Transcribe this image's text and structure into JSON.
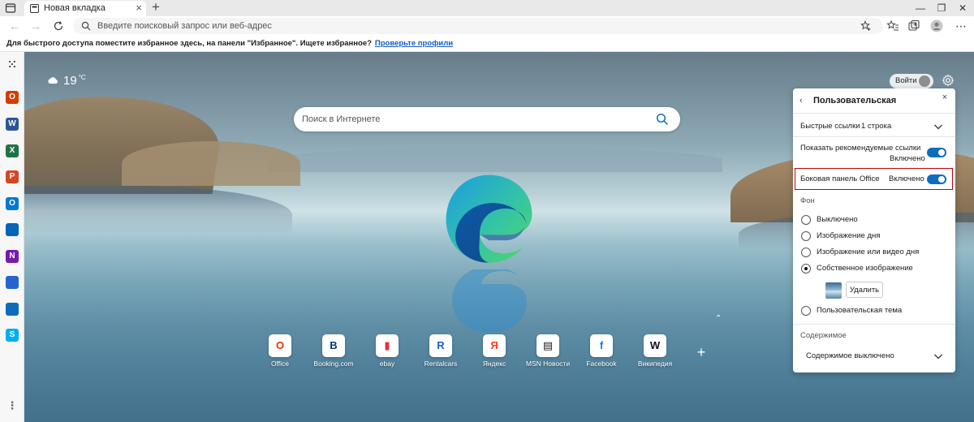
{
  "browser": {
    "tab_title": "Новая вкладка",
    "address_placeholder": "Введите поисковый запрос или веб-адрес"
  },
  "favorites_bar": {
    "message": "Для быстрого доступа поместите избранное здесь, на панели \"Избранное\". Ищете избранное?",
    "link": "Проверьте профили"
  },
  "sidebar": {
    "items": [
      {
        "name": "office-icon",
        "letter": "O",
        "color": "#d83b01"
      },
      {
        "name": "word-icon",
        "letter": "W",
        "color": "#2b579a"
      },
      {
        "name": "excel-icon",
        "letter": "X",
        "color": "#217346"
      },
      {
        "name": "powerpoint-icon",
        "letter": "P",
        "color": "#d24726"
      },
      {
        "name": "outlook-icon",
        "letter": "O",
        "color": "#0078d4"
      },
      {
        "name": "onedrive-icon",
        "letter": "",
        "color": "#0364b8"
      },
      {
        "name": "onenote-icon",
        "letter": "N",
        "color": "#7719aa"
      },
      {
        "name": "todo-icon",
        "letter": "",
        "color": "#2564cf"
      },
      {
        "name": "planner-icon",
        "letter": "",
        "color": "#0f6cbd"
      },
      {
        "name": "skype-icon",
        "letter": "S",
        "color": "#00aff0"
      }
    ]
  },
  "weather": {
    "temp": "19",
    "unit": "°C"
  },
  "header": {
    "login_label": "Войти"
  },
  "search": {
    "placeholder": "Поиск в Интернете"
  },
  "quick_links": [
    {
      "label": "Office",
      "glyph": "O",
      "color": "#d83b01"
    },
    {
      "label": "Booking.com",
      "glyph": "B",
      "color": "#003580"
    },
    {
      "label": "ebay",
      "glyph": "▮",
      "color": "#e53238"
    },
    {
      "label": "Rentalcars",
      "glyph": "R",
      "color": "#1a5ec7"
    },
    {
      "label": "Яндекс",
      "glyph": "Я",
      "color": "#fc3f1d"
    },
    {
      "label": "MSN Новости",
      "glyph": "▤",
      "color": "#222222"
    },
    {
      "label": "Facebook",
      "glyph": "f",
      "color": "#1877f2"
    },
    {
      "label": "Википедия",
      "glyph": "W",
      "color": "#111111"
    }
  ],
  "panel": {
    "title": "Пользовательская",
    "quick_links_label": "Быстрые ссылки",
    "quick_links_value": "1 строка",
    "recommended_label": "Показать рекомендуемые ссылки",
    "recommended_state": "Включено",
    "office_sidebar_label": "Боковая панель Office",
    "office_sidebar_state": "Включено",
    "background_heading": "Фон",
    "bg_options": [
      "Выключено",
      "Изображение дня",
      "Изображение или видео дня",
      "Собственное изображение"
    ],
    "bg_selected_index": 3,
    "delete_button": "Удалить",
    "custom_theme_label": "Пользовательская тема",
    "content_heading": "Содержимое",
    "content_value": "Содержимое выключено"
  },
  "colors": {
    "accent": "#0f6cbd",
    "highlight": "#c00000"
  }
}
